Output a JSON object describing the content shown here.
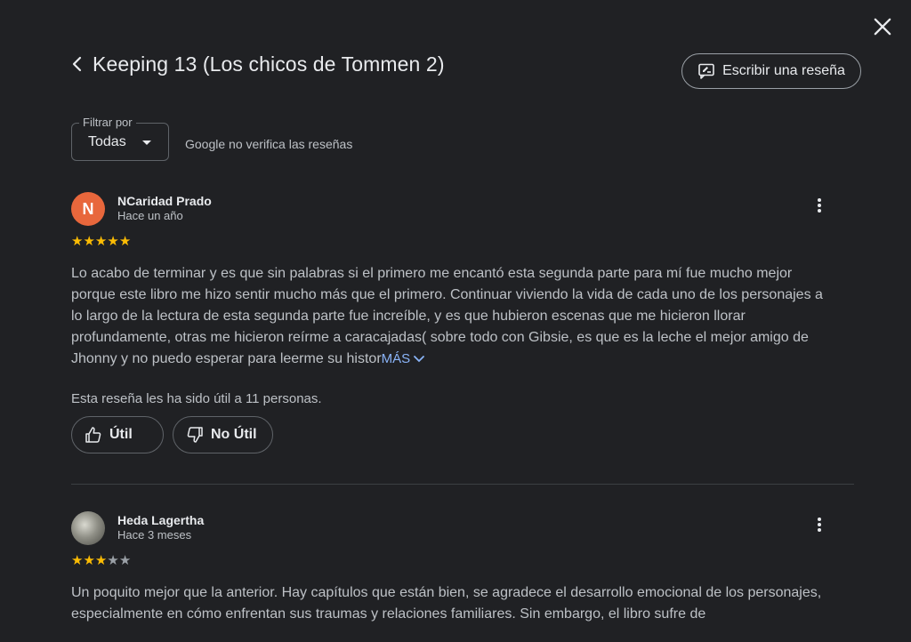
{
  "header": {
    "title": "Keeping 13 (Los chicos de Tommen 2)",
    "write_review_label": "Escribir una reseña"
  },
  "filter": {
    "label": "Filtrar por",
    "selected": "Todas",
    "notice": "Google no verifica las reseñas"
  },
  "reviews": [
    {
      "initial": "N",
      "author": "NCaridad Prado",
      "date": "Hace un año",
      "rating": 5,
      "avatar_color": "#e8673c",
      "text": "Lo acabo de terminar y es que sin palabras si el primero me encantó esta segunda parte para mí fue mucho mejor porque este libro me hizo sentir mucho más que el primero. Continuar viviendo la vida de cada uno de los personajes a lo largo de la lectura de esta segunda parte fue increíble, y es que hubieron escenas que me hicieron llorar profundamente, otras me hicieron reírme a caracajadas( sobre todo con Gibsie, es que es la leche el mejor amigo de Jhonny y no puedo esperar para leerme su histor",
      "more_label": "MÁS",
      "helpful_text": "Esta reseña les ha sido útil a 11 personas.",
      "useful_label": "Útil",
      "not_useful_label": "No Útil"
    },
    {
      "author": "Heda Lagertha",
      "date": "Hace 3 meses",
      "rating": 3,
      "text": "Un poquito mejor que la anterior. Hay capítulos que están bien, se agradece el desarrollo emocional de los personajes, especialmente en cómo enfrentan sus traumas y relaciones familiares. Sin embargo, el libro sufre de"
    }
  ],
  "colors": {
    "background": "#202124",
    "star": "#fbbc04",
    "link": "#8ab4f8"
  }
}
